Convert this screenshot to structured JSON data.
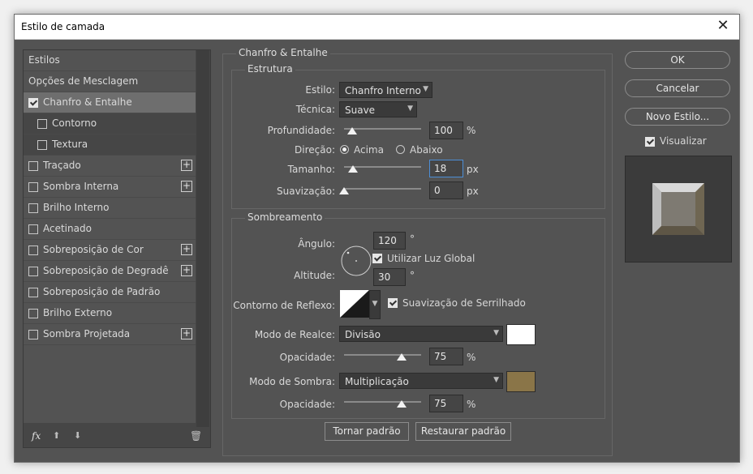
{
  "window": {
    "title": "Estilo de camada"
  },
  "left_list": {
    "items": [
      {
        "label": "Estilos",
        "checkbox": false,
        "checked": false,
        "plus": false,
        "level": 0,
        "selected": false
      },
      {
        "label": "Opções de Mesclagem",
        "checkbox": false,
        "checked": false,
        "plus": false,
        "level": 0,
        "selected": false
      },
      {
        "label": "Chanfro & Entalhe",
        "checkbox": true,
        "checked": true,
        "plus": false,
        "level": 0,
        "selected": true
      },
      {
        "label": "Contorno",
        "checkbox": true,
        "checked": false,
        "plus": false,
        "level": 1,
        "selected": false
      },
      {
        "label": "Textura",
        "checkbox": true,
        "checked": false,
        "plus": false,
        "level": 1,
        "selected": false
      },
      {
        "label": "Traçado",
        "checkbox": true,
        "checked": false,
        "plus": true,
        "level": 0,
        "selected": false
      },
      {
        "label": "Sombra Interna",
        "checkbox": true,
        "checked": false,
        "plus": true,
        "level": 0,
        "selected": false
      },
      {
        "label": "Brilho Interno",
        "checkbox": true,
        "checked": false,
        "plus": false,
        "level": 0,
        "selected": false
      },
      {
        "label": "Acetinado",
        "checkbox": true,
        "checked": false,
        "plus": false,
        "level": 0,
        "selected": false
      },
      {
        "label": "Sobreposição de Cor",
        "checkbox": true,
        "checked": false,
        "plus": true,
        "level": 0,
        "selected": false
      },
      {
        "label": "Sobreposição de Degradê",
        "checkbox": true,
        "checked": false,
        "plus": true,
        "level": 0,
        "selected": false
      },
      {
        "label": "Sobreposição de Padrão",
        "checkbox": true,
        "checked": false,
        "plus": false,
        "level": 0,
        "selected": false
      },
      {
        "label": "Brilho Externo",
        "checkbox": true,
        "checked": false,
        "plus": false,
        "level": 0,
        "selected": false
      },
      {
        "label": "Sombra Projetada",
        "checkbox": true,
        "checked": false,
        "plus": true,
        "level": 0,
        "selected": false
      }
    ],
    "toolbar": {
      "fx": "fx",
      "up": "⬆",
      "down": "⬇",
      "trash": "🗑"
    }
  },
  "bevel": {
    "title": "Chanfro & Entalhe",
    "structure": {
      "title": "Estrutura",
      "style_label": "Estilo:",
      "style_value": "Chanfro Interno",
      "technique_label": "Técnica:",
      "technique_value": "Suave",
      "depth_label": "Profundidade:",
      "depth_value": "100",
      "depth_unit": "%",
      "depth_fraction": 0.1,
      "direction_label": "Direção:",
      "direction_up": "Acima",
      "direction_down": "Abaixo",
      "direction_selected": "Acima",
      "size_label": "Tamanho:",
      "size_value": "18",
      "size_unit": "px",
      "size_fraction": 0.12,
      "soften_label": "Suavização:",
      "soften_value": "0",
      "soften_unit": "px",
      "soften_fraction": 0.0
    },
    "shading": {
      "title": "Sombreamento",
      "angle_label": "Ângulo:",
      "angle_value": "120",
      "angle_unit": "°",
      "global_light_label": "Utilizar Luz Global",
      "global_light_checked": true,
      "altitude_label": "Altitude:",
      "altitude_value": "30",
      "altitude_unit": "°",
      "gloss_label": "Contorno de Reflexo:",
      "antialias_label": "Suavização de Serrilhado",
      "antialias_checked": true,
      "highlight_mode_label": "Modo de Realce:",
      "highlight_mode_value": "Divisão",
      "highlight_color": "#ffffff",
      "highlight_opacity_label": "Opacidade:",
      "highlight_opacity_value": "75",
      "highlight_opacity_unit": "%",
      "highlight_opacity_fraction": 0.75,
      "shadow_mode_label": "Modo de Sombra:",
      "shadow_mode_value": "Multiplicação",
      "shadow_color": "#8a7548",
      "shadow_opacity_label": "Opacidade:",
      "shadow_opacity_value": "75",
      "shadow_opacity_unit": "%",
      "shadow_opacity_fraction": 0.75
    },
    "make_default": "Tornar padrão",
    "reset_default": "Restaurar padrão"
  },
  "right": {
    "ok": "OK",
    "cancel": "Cancelar",
    "new_style": "Novo Estilo...",
    "preview_label": "Visualizar",
    "preview_checked": true
  }
}
